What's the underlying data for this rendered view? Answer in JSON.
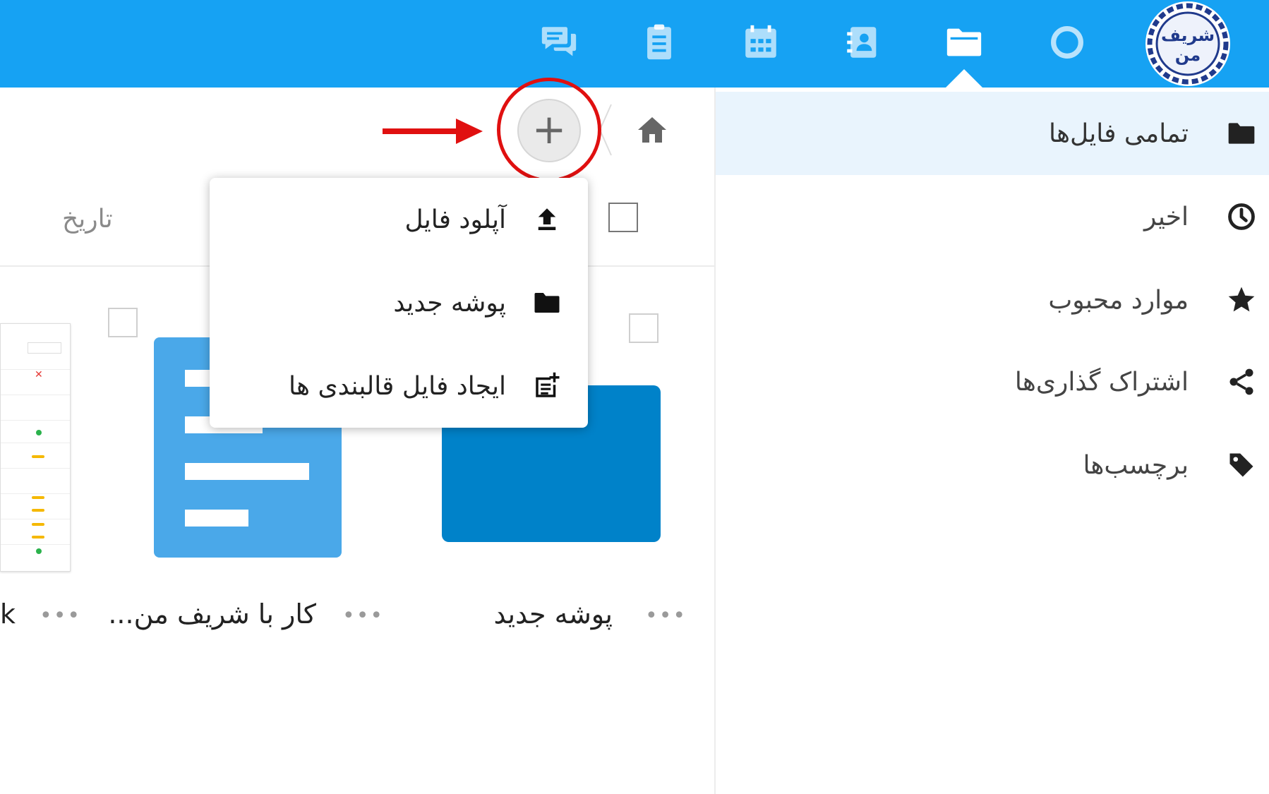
{
  "topbar": {
    "apps": [
      {
        "name": "talk",
        "icon": "chat-icon"
      },
      {
        "name": "tasks",
        "icon": "clipboard-icon"
      },
      {
        "name": "calendar",
        "icon": "calendar-icon"
      },
      {
        "name": "contacts",
        "icon": "contacts-icon"
      },
      {
        "name": "files",
        "icon": "folder-open-icon",
        "active": true
      },
      {
        "name": "dashboard",
        "icon": "circle-icon"
      }
    ],
    "logo_text": "شریف من",
    "color": "#16a2f3"
  },
  "nav": {
    "items": [
      {
        "label": "تمامی فایل‌ها",
        "icon": "folder-icon",
        "active": true
      },
      {
        "label": "اخیر",
        "icon": "clock-icon"
      },
      {
        "label": "موارد محبوب",
        "icon": "star-icon"
      },
      {
        "label": "اشتراک گذاری‌ها",
        "icon": "share-icon"
      },
      {
        "label": "برچسب‌ها",
        "icon": "tag-icon"
      }
    ]
  },
  "toolbar": {
    "add_label": "+",
    "home_icon": "home-icon"
  },
  "list_header": {
    "date_label": "تاریخ"
  },
  "new_menu": {
    "items": [
      {
        "label": "آپلود فایل",
        "icon": "upload-icon"
      },
      {
        "label": "پوشه جدید",
        "icon": "folder-icon"
      },
      {
        "label": "ایجاد فایل قالبندی ها",
        "icon": "template-icon"
      }
    ]
  },
  "files": [
    {
      "name": "پوشه جدید",
      "type": "folder",
      "more": "•••"
    },
    {
      "name": "...کار با شریف من",
      "type": "document",
      "more": "•••"
    },
    {
      "name": "k",
      "type": "spreadsheet",
      "more": "•••"
    }
  ],
  "colors": {
    "accent": "#0082c9",
    "document": "#4aa8e9",
    "highlight": "#e01010"
  }
}
